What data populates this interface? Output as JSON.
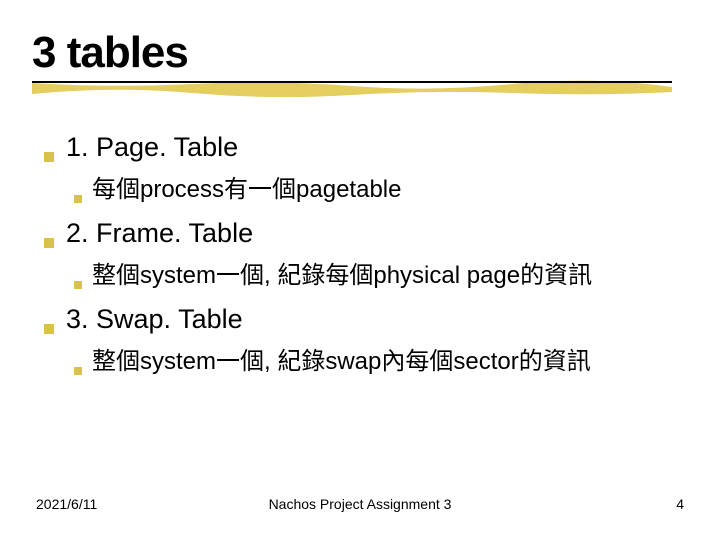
{
  "title": "3 tables",
  "items": [
    {
      "heading": "1. Page. Table",
      "sub": "每個process有一個pagetable"
    },
    {
      "heading": "2. Frame. Table",
      "sub": "整個system一個, 紀錄每個physical page的資訊"
    },
    {
      "heading": "3. Swap. Table",
      "sub": "整個system一個, 紀錄swap內每個sector的資訊"
    }
  ],
  "footer": {
    "date": "2021/6/11",
    "center": "Nachos Project Assignment 3",
    "page": "4"
  }
}
